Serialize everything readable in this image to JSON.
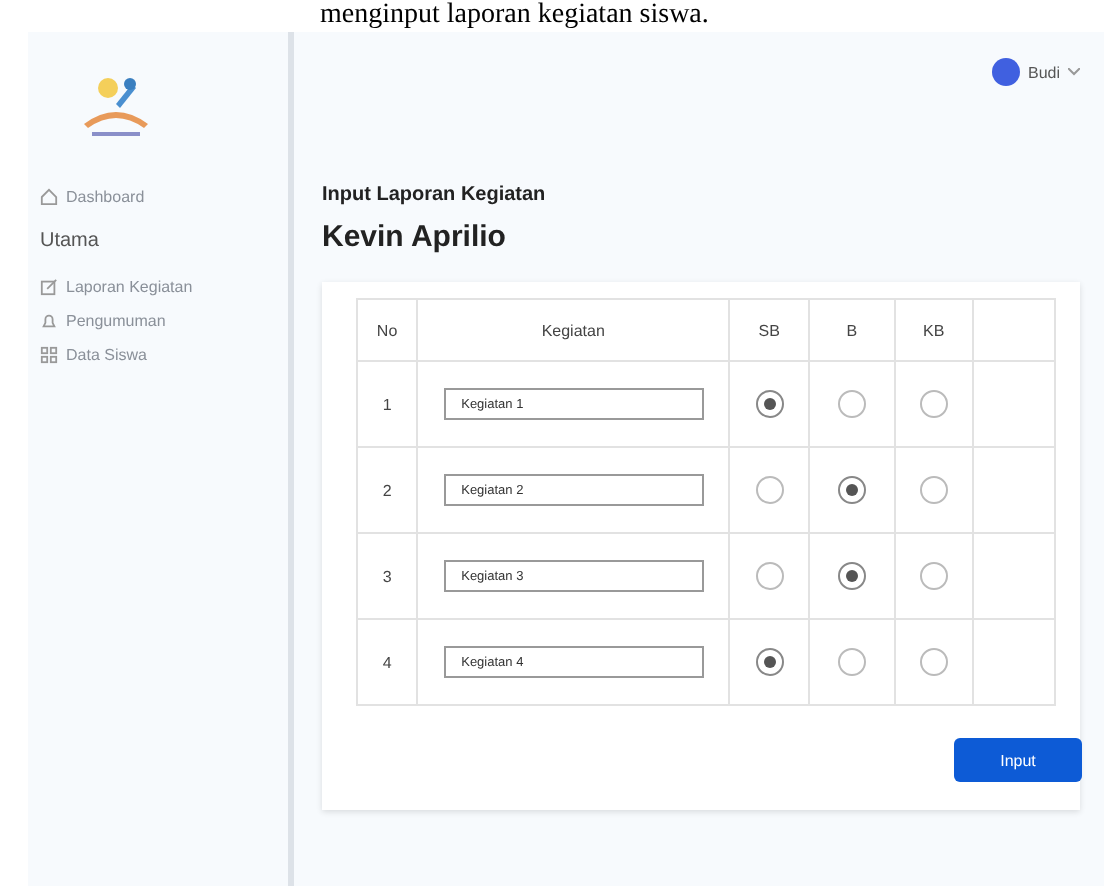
{
  "caption": "menginput laporan kegiatan siswa.",
  "user": {
    "name": "Budi"
  },
  "sidebar": {
    "items": [
      {
        "kind": "link",
        "label": "Dashboard"
      },
      {
        "kind": "heading",
        "label": "Utama"
      },
      {
        "kind": "link",
        "label": "Laporan Kegiatan"
      },
      {
        "kind": "link",
        "label": "Pengumuman"
      },
      {
        "kind": "link",
        "label": "Data Siswa"
      }
    ]
  },
  "page": {
    "title": "Input Laporan Kegiatan",
    "student": "Kevin Aprilio"
  },
  "table": {
    "columns": [
      "No",
      "Kegiatan",
      "SB",
      "B",
      "KB"
    ],
    "rows": [
      {
        "no": "1",
        "activity": "Kegiatan 1",
        "ratings": [
          {
            "selected": true
          },
          {
            "selected": false
          },
          {
            "selected": false
          }
        ]
      },
      {
        "no": "2",
        "activity": "Kegiatan 2",
        "ratings": [
          {
            "selected": false
          },
          {
            "selected": true
          },
          {
            "selected": false
          }
        ]
      },
      {
        "no": "3",
        "activity": "Kegiatan 3",
        "ratings": [
          {
            "selected": false
          },
          {
            "selected": true
          },
          {
            "selected": false
          }
        ]
      },
      {
        "no": "4",
        "activity": "Kegiatan 4",
        "ratings": [
          {
            "selected": true
          },
          {
            "selected": false
          },
          {
            "selected": false
          }
        ]
      }
    ]
  },
  "submit": "Input"
}
